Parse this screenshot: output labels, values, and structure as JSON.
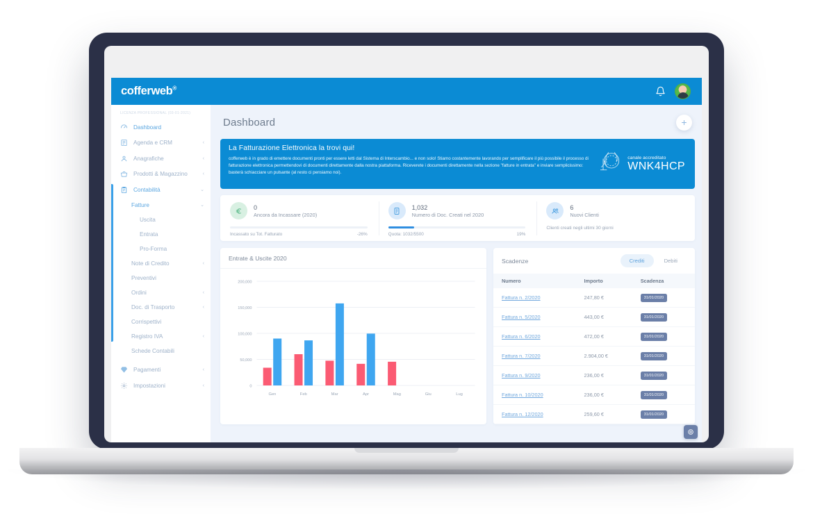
{
  "app": {
    "logo": "cofferweb",
    "logo_mark": "®"
  },
  "topbar": {
    "notifications_icon": "bell-icon",
    "avatar_label": "user-avatar"
  },
  "sidebar": {
    "license": "LICENZA PROFESSIONAL (03-01-2021)",
    "items": [
      {
        "label": "Dashboard",
        "icon": "dashboard-icon",
        "chevron": "",
        "active": true
      },
      {
        "label": "Agenda e CRM",
        "icon": "calendar-icon",
        "chevron": "‹"
      },
      {
        "label": "Anagrafiche",
        "icon": "user-icon",
        "chevron": "‹"
      },
      {
        "label": "Prodotti & Magazzino",
        "icon": "basket-icon",
        "chevron": "‹"
      },
      {
        "label": "Contabilità",
        "icon": "clipboard-icon",
        "chevron": "⌄",
        "open": true
      }
    ],
    "sub_items": [
      {
        "label": "Fatture",
        "chevron": "⌄",
        "level": 1,
        "open": true
      },
      {
        "label": "Uscita",
        "chevron": "",
        "level": 2
      },
      {
        "label": "Entrata",
        "chevron": "",
        "level": 2
      },
      {
        "label": "Pro-Forma",
        "chevron": "",
        "level": 2
      },
      {
        "label": "Note di Credito",
        "chevron": "‹",
        "level": 1
      },
      {
        "label": "Preventivi",
        "chevron": "",
        "level": 1
      },
      {
        "label": "Ordini",
        "chevron": "‹",
        "level": 1
      },
      {
        "label": "Doc. di Trasporto",
        "chevron": "‹",
        "level": 1
      },
      {
        "label": "Corrispettivi",
        "chevron": "",
        "level": 1
      },
      {
        "label": "Registro IVA",
        "chevron": "‹",
        "level": 1
      },
      {
        "label": "Schede Contabili",
        "chevron": "",
        "level": 1
      }
    ],
    "footer_items": [
      {
        "label": "Pagamenti",
        "icon": "diamond-icon",
        "chevron": "‹"
      },
      {
        "label": "Impostazioni",
        "icon": "gear-icon",
        "chevron": "‹"
      }
    ]
  },
  "page": {
    "title": "Dashboard",
    "add_button": "+"
  },
  "banner": {
    "heading": "La Fatturazione Elettronica la trovi qui!",
    "body": "cofferweb è in grado di emettere documenti pronti per essere letti dal Sistema di Interscambio... e non solo! Stiamo costantemente lavorando per semplificare il più possibile il processo di fatturazione elettronica permettendovi di documenti direttamente dalla nostra piattaforma. Riceverete i documenti direttamente nella sezione \"fatture in entrata\" e inviare semplicissimo: basterà schiacciare un pulsante (al resto ci pensiamo noi).",
    "badge_small": "canale accreditato",
    "badge_code": "WNK4HCP",
    "emblem_icon": "italian-republic-emblem-icon",
    "bg_color": "#0b8bd4"
  },
  "stats": [
    {
      "value": "0",
      "label": "Ancora da Incassare (2020)",
      "icon": "euro-icon",
      "icon_bg": "#d8f0e2",
      "icon_color": "#5cba8a",
      "bar_pct": 0,
      "bar_color": "#e8f6ee",
      "foot_left": "Incassato su Tot. Fatturato",
      "foot_right": "-26%"
    },
    {
      "value": "1,032",
      "label": "Numero di Doc. Creati nel 2020",
      "icon": "document-icon",
      "icon_bg": "#d9eafb",
      "icon_color": "#4a9fe0",
      "bar_pct": 19,
      "bar_color": "#2f8ee0",
      "foot_left": "Quota: 1032/5500",
      "foot_right": "19%"
    },
    {
      "value": "6",
      "label": "Nuovi Clienti",
      "icon": "users-icon",
      "icon_bg": "#d9eafb",
      "icon_color": "#4a9fe0",
      "note": "Clienti creati negli ultimi 30 giorni"
    }
  ],
  "chart_data": {
    "type": "bar",
    "title": "Entrate & Uscite 2020",
    "categories": [
      "Gen",
      "Feb",
      "Mar",
      "Apr",
      "Mag",
      "Giu",
      "Lug"
    ],
    "series": [
      {
        "name": "Uscite",
        "color": "#fb5b73",
        "values": [
          34000,
          60000,
          47500,
          41500,
          45500,
          0,
          0
        ]
      },
      {
        "name": "Entrate",
        "color": "#3fa6f0",
        "values": [
          90000,
          86500,
          157500,
          99500,
          0,
          0,
          0
        ]
      }
    ],
    "ylim": [
      0,
      200000
    ],
    "yticks": [
      0,
      50000,
      100000,
      150000,
      200000
    ],
    "ytick_labels": [
      "0",
      "50,000",
      "100,000",
      "150,000",
      "200,000"
    ],
    "xlabel": "",
    "ylabel": "",
    "grid": true,
    "legend": "none"
  },
  "scadenze": {
    "title": "Scadenze",
    "tabs": [
      {
        "label": "Crediti",
        "active": true
      },
      {
        "label": "Debiti",
        "active": false
      }
    ],
    "columns": [
      "Numero",
      "Importo",
      "Scadenza"
    ],
    "rows": [
      {
        "numero": "Fattura n. 2/2020",
        "importo": "247,80 €",
        "scadenza": "31/01/2020"
      },
      {
        "numero": "Fattura n. 5/2020",
        "importo": "443,00 €",
        "scadenza": "31/01/2020"
      },
      {
        "numero": "Fattura n. 6/2020",
        "importo": "472,00 €",
        "scadenza": "31/01/2020"
      },
      {
        "numero": "Fattura n. 7/2020",
        "importo": "2.904,00 €",
        "scadenza": "31/01/2020"
      },
      {
        "numero": "Fattura n. 9/2020",
        "importo": "236,00 €",
        "scadenza": "31/01/2020"
      },
      {
        "numero": "Fattura n. 10/2020",
        "importo": "236,00 €",
        "scadenza": "31/01/2020"
      },
      {
        "numero": "Fattura n. 12/2020",
        "importo": "259,60 €",
        "scadenza": "31/01/2020"
      }
    ]
  },
  "corner_button": {
    "icon": "target-icon"
  },
  "colors": {
    "brand": "#0b8bd4",
    "bg": "#eef3fb",
    "accent": "#3aa0e8",
    "bar_red": "#fb5b73",
    "bar_blue": "#3fa6f0",
    "pill": "#6b7fa8"
  }
}
